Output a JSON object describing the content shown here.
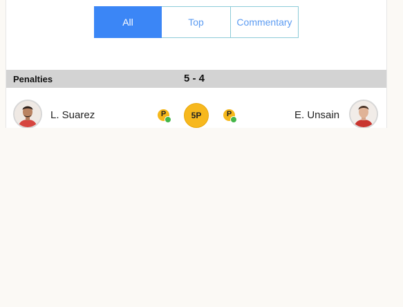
{
  "tabs": [
    {
      "label": "All",
      "active": true
    },
    {
      "label": "Top",
      "active": false
    },
    {
      "label": "Commentary",
      "active": false
    }
  ],
  "penalties": {
    "title": "Penalties",
    "score": "5 - 4"
  },
  "row": {
    "left_player": "L. Suarez",
    "right_player": "E. Unsain",
    "left_icon_letter": "P",
    "right_icon_letter": "P",
    "round": "5P"
  },
  "colors": {
    "accent": "#3b86f6",
    "penalty_badge": "#f7b81e",
    "scored_check": "#43b649",
    "section_bar": "#d3d3d3"
  }
}
